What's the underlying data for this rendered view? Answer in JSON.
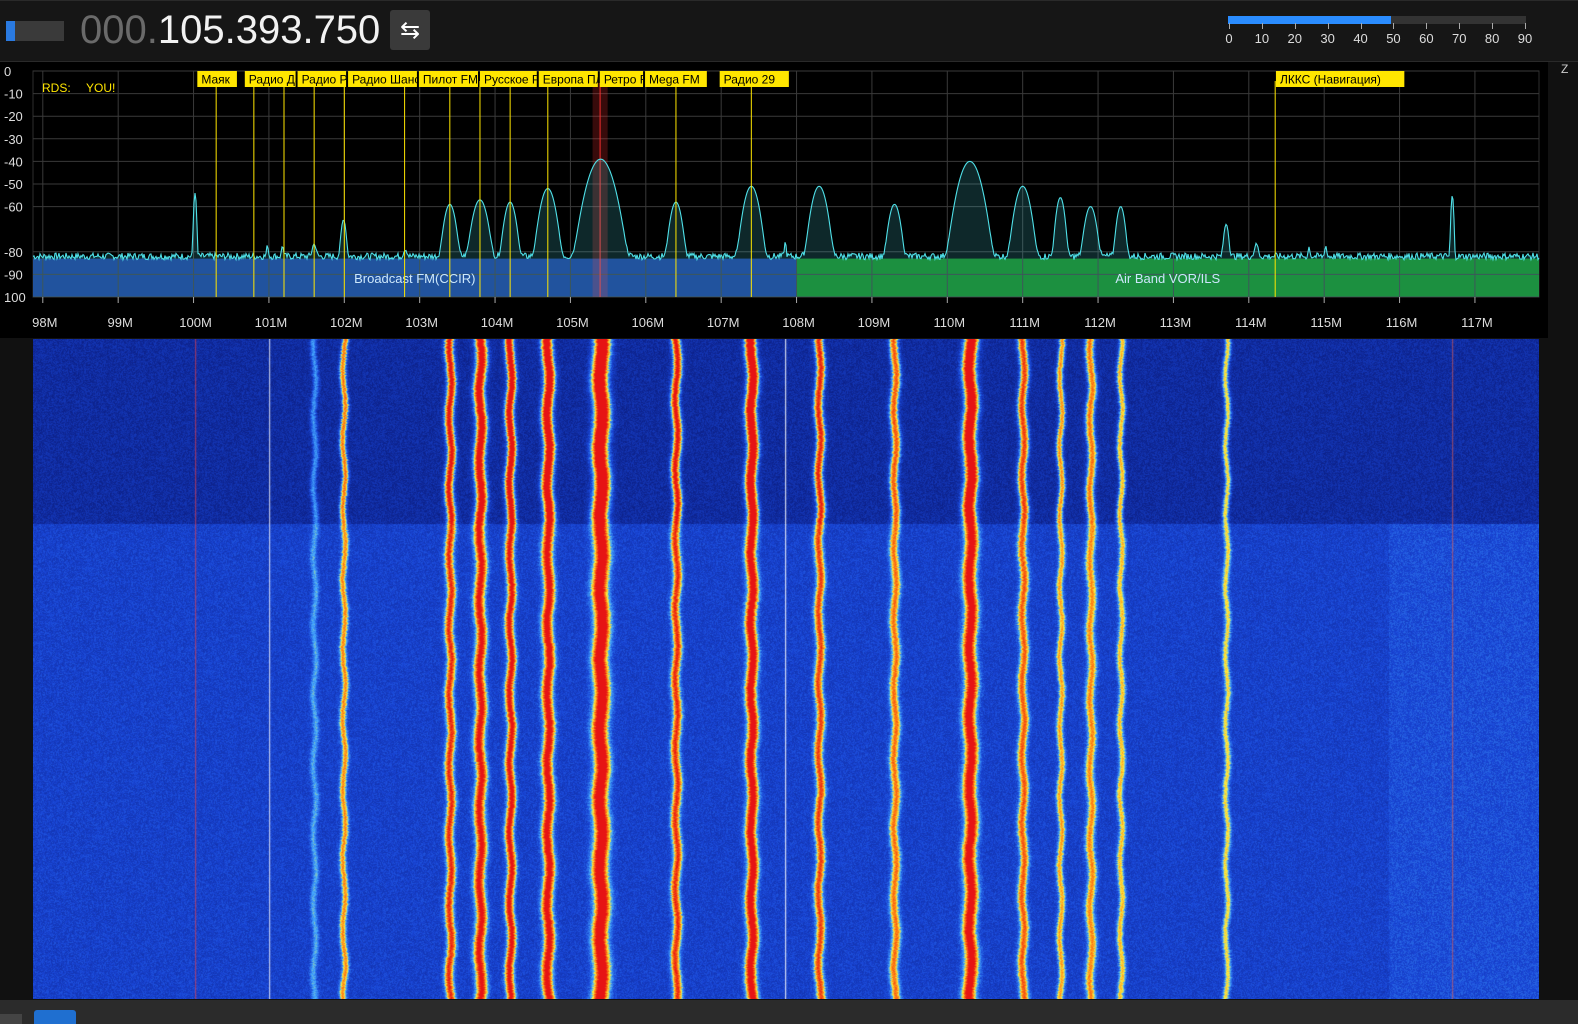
{
  "header": {
    "freq_dim": "000.",
    "freq_main": "105.393.750",
    "swap_icon": "⇆",
    "signal_level": 0.15,
    "scale": {
      "ticks": [
        "0",
        "10",
        "20",
        "30",
        "40",
        "50",
        "60",
        "70",
        "80",
        "90"
      ],
      "value": 52,
      "max": 95
    }
  },
  "side_label": "Z",
  "colors": {
    "fm_band": "#1a3a9a",
    "air_band": "#138a1e",
    "trace": "#4fe0e8",
    "marker": "#ffe600",
    "tuned": "#ff3030"
  },
  "chart_data": {
    "type": "line",
    "title": "",
    "xlabel": "",
    "ylabel": "",
    "x_unit": "MHz",
    "xlim": [
      97.87,
      117.85
    ],
    "ylim": [
      -100,
      0
    ],
    "x_ticks": [
      {
        "v": 98,
        "label": "98M"
      },
      {
        "v": 99,
        "label": "99M"
      },
      {
        "v": 100,
        "label": "100M"
      },
      {
        "v": 101,
        "label": "101M"
      },
      {
        "v": 102,
        "label": "102M"
      },
      {
        "v": 103,
        "label": "103M"
      },
      {
        "v": 104,
        "label": "104M"
      },
      {
        "v": 105,
        "label": "105M"
      },
      {
        "v": 106,
        "label": "106M"
      },
      {
        "v": 107,
        "label": "107M"
      },
      {
        "v": 108,
        "label": "108M"
      },
      {
        "v": 109,
        "label": "109M"
      },
      {
        "v": 110,
        "label": "110M"
      },
      {
        "v": 111,
        "label": "111M"
      },
      {
        "v": 112,
        "label": "112M"
      },
      {
        "v": 113,
        "label": "113M"
      },
      {
        "v": 114,
        "label": "114M"
      },
      {
        "v": 115,
        "label": "115M"
      },
      {
        "v": 116,
        "label": "116M"
      },
      {
        "v": 117,
        "label": "117M"
      }
    ],
    "y_ticks": [
      {
        "v": 0,
        "label": "0"
      },
      {
        "v": -10,
        "label": "-10"
      },
      {
        "v": -20,
        "label": "-20"
      },
      {
        "v": -30,
        "label": "-30"
      },
      {
        "v": -40,
        "label": "-40"
      },
      {
        "v": -50,
        "label": "-50"
      },
      {
        "v": -60,
        "label": "-60"
      },
      {
        "v": -80,
        "label": "-80"
      },
      {
        "v": -90,
        "label": "-90"
      },
      {
        "v": -100,
        "label": "100"
      }
    ],
    "noise_floor": -82,
    "peaks": [
      {
        "f": 100.02,
        "db": -54,
        "w": 0.01
      },
      {
        "f": 100.98,
        "db": -79,
        "w": 0.01
      },
      {
        "f": 101.18,
        "db": -79,
        "w": 0.01
      },
      {
        "f": 101.6,
        "db": -78,
        "w": 0.02
      },
      {
        "f": 101.99,
        "db": -66,
        "w": 0.02
      },
      {
        "f": 102.81,
        "db": -82,
        "w": 0.02
      },
      {
        "f": 103.4,
        "db": -59,
        "w": 0.04
      },
      {
        "f": 103.8,
        "db": -57,
        "w": 0.05
      },
      {
        "f": 104.2,
        "db": -58,
        "w": 0.04
      },
      {
        "f": 104.7,
        "db": -52,
        "w": 0.05
      },
      {
        "f": 105.4,
        "db": -39,
        "w": 0.08
      },
      {
        "f": 106.4,
        "db": -58,
        "w": 0.04
      },
      {
        "f": 107.4,
        "db": -51,
        "w": 0.05
      },
      {
        "f": 107.85,
        "db": -77,
        "w": 0.01
      },
      {
        "f": 108.3,
        "db": -51,
        "w": 0.05
      },
      {
        "f": 109.3,
        "db": -59,
        "w": 0.04
      },
      {
        "f": 110.3,
        "db": -40,
        "w": 0.07
      },
      {
        "f": 111.0,
        "db": -51,
        "w": 0.05
      },
      {
        "f": 111.5,
        "db": -56,
        "w": 0.03
      },
      {
        "f": 111.9,
        "db": -60,
        "w": 0.04
      },
      {
        "f": 112.3,
        "db": -60,
        "w": 0.03
      },
      {
        "f": 113.7,
        "db": -68,
        "w": 0.02
      },
      {
        "f": 114.1,
        "db": -78,
        "w": 0.02
      },
      {
        "f": 114.8,
        "db": -80,
        "w": 0.01
      },
      {
        "f": 115.02,
        "db": -79,
        "w": 0.01
      },
      {
        "f": 116.7,
        "db": -55,
        "w": 0.01
      }
    ],
    "bands": [
      {
        "name": "Broadcast FM(CCIR)",
        "start": 97.87,
        "end": 108.0,
        "color": "#1a3a9a"
      },
      {
        "name": "Air Band VOR/ILS",
        "start": 108.0,
        "end": 117.85,
        "color": "#138a1e"
      }
    ],
    "tuned_frequency": 105.39375,
    "tuned_bandwidth": 0.2,
    "rds": {
      "label": "RDS:",
      "value": "YOU!"
    },
    "station_labels": [
      {
        "name": "Маяк",
        "label_start": 100.05,
        "f": 100.3
      },
      {
        "name": "Радио Дача",
        "label_start": 100.68,
        "f": 100.8
      },
      {
        "name": "Радио России",
        "label_start": 101.38,
        "f": 101.2
      },
      {
        "name": "Радио Шансон",
        "label_start": 102.05,
        "f": 101.6
      },
      {
        "name": "Пилот FM",
        "label_start": 102.99,
        "f": 102.0
      },
      {
        "name": "Русское Радио",
        "label_start": 103.8,
        "f": 102.8
      },
      {
        "name": "Европа Плюс",
        "label_start": 104.58,
        "f": 103.4
      },
      {
        "name": "Ретро FM",
        "label_start": 105.39,
        "f": 103.8
      },
      {
        "name": "Mega FM",
        "label_start": 105.99,
        "f": 104.2
      },
      {
        "name": "Радио 29",
        "label_start": 106.98,
        "f": 104.7
      },
      {
        "name": "ЛККС (Навигация)",
        "label_start": 114.36,
        "f": 106.4
      }
    ],
    "station_lines": [
      100.3,
      100.8,
      101.2,
      101.6,
      102.0,
      102.8,
      103.4,
      103.8,
      104.2,
      104.7,
      106.4,
      107.4,
      114.35
    ],
    "waterfall_traces": [
      {
        "f": 100.02,
        "intensity": 0.55,
        "type": "carrier",
        "color": "#ff4040"
      },
      {
        "f": 101.0,
        "intensity": 0.7,
        "type": "carrier",
        "color": "#ffffff"
      },
      {
        "f": 101.6,
        "intensity": 0.5,
        "w": 0.02
      },
      {
        "f": 101.99,
        "intensity": 1.2,
        "w": 0.02
      },
      {
        "f": 103.4,
        "intensity": 1.6,
        "w": 0.04
      },
      {
        "f": 103.8,
        "intensity": 1.8,
        "w": 0.05
      },
      {
        "f": 104.2,
        "intensity": 1.8,
        "w": 0.04
      },
      {
        "f": 104.7,
        "intensity": 1.9,
        "w": 0.05
      },
      {
        "f": 105.4,
        "intensity": 2.2,
        "w": 0.07
      },
      {
        "f": 106.4,
        "intensity": 1.6,
        "w": 0.04
      },
      {
        "f": 107.4,
        "intensity": 2.0,
        "w": 0.05
      },
      {
        "f": 107.85,
        "intensity": 0.8,
        "type": "carrier",
        "color": "#ffffff"
      },
      {
        "f": 108.3,
        "intensity": 1.5,
        "w": 0.04
      },
      {
        "f": 109.3,
        "intensity": 1.3,
        "w": 0.04
      },
      {
        "f": 110.3,
        "intensity": 2.0,
        "w": 0.06
      },
      {
        "f": 111.0,
        "intensity": 1.4,
        "w": 0.04
      },
      {
        "f": 111.5,
        "intensity": 1.1,
        "w": 0.03
      },
      {
        "f": 111.9,
        "intensity": 1.2,
        "w": 0.04
      },
      {
        "f": 112.3,
        "intensity": 1.0,
        "w": 0.03
      },
      {
        "f": 113.7,
        "intensity": 0.9,
        "w": 0.02
      },
      {
        "f": 116.7,
        "intensity": 0.5,
        "type": "carrier",
        "color": "#ff6040"
      }
    ],
    "waterfall_split": 0.28
  }
}
